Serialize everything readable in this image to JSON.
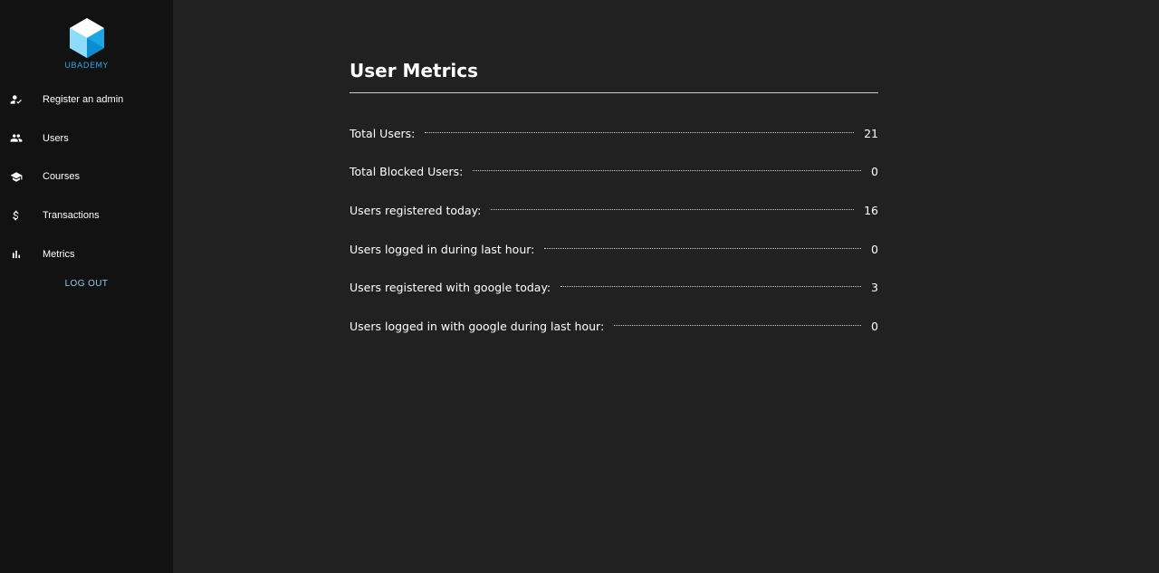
{
  "app": {
    "logo_text": "UBADEMY"
  },
  "sidebar": {
    "items": [
      {
        "label": "Register an admin",
        "icon": "person-check-icon"
      },
      {
        "label": "Users",
        "icon": "people-icon"
      },
      {
        "label": "Courses",
        "icon": "school-icon"
      },
      {
        "label": "Transactions",
        "icon": "dollar-icon"
      },
      {
        "label": "Metrics",
        "icon": "bar-chart-icon"
      }
    ],
    "logout_label": "LOG OUT"
  },
  "main": {
    "title": "User Metrics",
    "metrics": [
      {
        "label": "Total Users:",
        "value": "21"
      },
      {
        "label": "Total Blocked Users:",
        "value": "0"
      },
      {
        "label": "Users registered today:",
        "value": "16"
      },
      {
        "label": "Users logged in during last hour:",
        "value": "0"
      },
      {
        "label": "Users registered with google today:",
        "value": "3"
      },
      {
        "label": "Users logged in with google during last hour:",
        "value": "0"
      }
    ]
  },
  "colors": {
    "sidebar_bg": "#121212",
    "main_bg": "#212121",
    "logo_accent": "#29a3e0",
    "logout_link": "#90caf9"
  }
}
